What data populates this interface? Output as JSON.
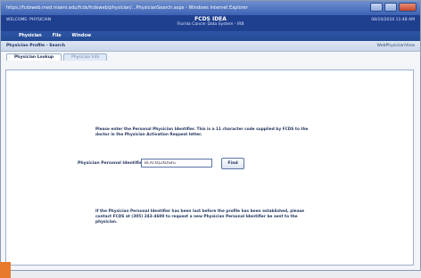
{
  "browser": {
    "title": "https://fcdsweb.med.miami.edu/fcds/fcdsweb/physician/...PhysicianSearch.aspx - Windows Internet Explorer"
  },
  "app_header": {
    "left_text": "WELCOME: PHYSICIAN",
    "title": "FCDS IDEA",
    "subtitle": "Florida Cancer Data System - IRB",
    "right_text": "08/10/2010 11:48 AM"
  },
  "menu": [
    "Physician",
    "File",
    "Window"
  ],
  "panel": {
    "title": "Physician Profile - Search",
    "right_label": "WebPhysicianView"
  },
  "tabs": [
    {
      "label": "Physician Lookup",
      "active": true
    },
    {
      "label": "Physician Info",
      "active": false
    }
  ],
  "form": {
    "instruction": "Please enter the Personal Physician Identifier. This is a 11 character code supplied by FCDS to the doctor in the Physician Activation Request letter.",
    "label": "Physician Personal Identifier:",
    "value": "BCAT4Q2XDS4G",
    "button": "Find",
    "note": "If the Physician Personal Identifier has been lost before the profile has been established, please contact FCDS at (305) 243-4600 to request a new Physician Personal Identifier be sent to the physician."
  }
}
